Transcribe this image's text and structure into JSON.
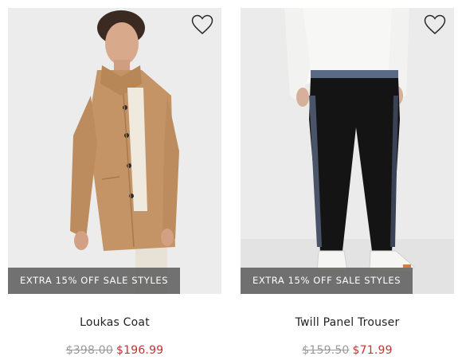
{
  "products": [
    {
      "name": "Loukas Coat",
      "badge": "EXTRA 15% OFF SALE STYLES",
      "original_price": "$398.00",
      "sale_price": "$196.99",
      "image_subject": "man-in-camel-coat",
      "wishlist_icon": "heart-outline-icon"
    },
    {
      "name": "Twill Panel Trouser",
      "badge": "EXTRA 15% OFF SALE STYLES",
      "original_price": "$159.50",
      "sale_price": "$71.99",
      "image_subject": "black-trousers-white-sneakers",
      "wishlist_icon": "heart-outline-icon"
    }
  ],
  "colors": {
    "sale_price": "#c8322f",
    "original_price": "#9a9a9a",
    "badge_background": "#666666",
    "image_background": "#ebebeb"
  }
}
